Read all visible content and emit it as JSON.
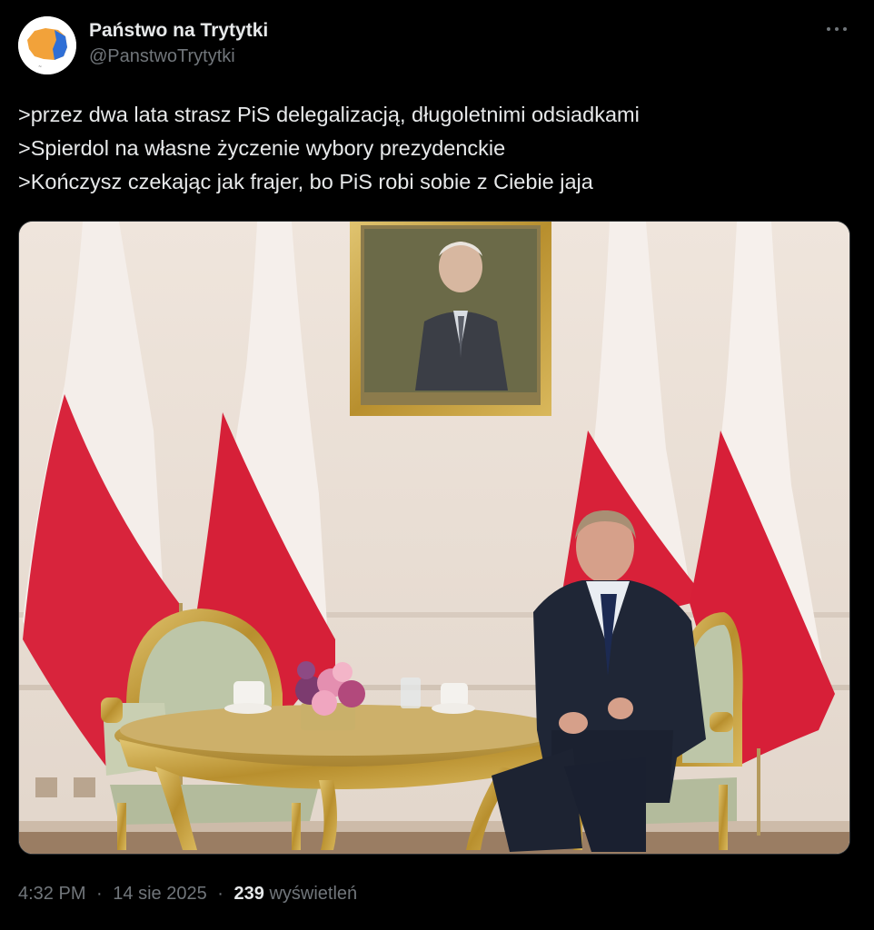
{
  "tweet": {
    "author": {
      "display_name": "Państwo na Trytytki",
      "handle": "@PanstwoTrytytki",
      "avatar_icon": "avatar-poland-map-icon"
    },
    "more_icon": "more-dots-icon",
    "lines": [
      ">przez dwa lata strasz PiS delegalizacją, długoletnimi odsiadkami",
      ">Spierdol na własne życzenie wybory prezydenckie",
      ">Kończysz czekając jak frajer, bo PiS robi sobie z Ciebie jaja"
    ],
    "time": "4:32 PM",
    "date": "14 sie 2025",
    "views_count": "239",
    "views_label": "wyświetleń",
    "separator": "·"
  },
  "colors": {
    "background": "#000000",
    "text": "#e7e9ea",
    "muted": "#71767b",
    "flag_red": "#dc1f3b",
    "flag_white": "#f6f1ee",
    "gold": "#c9a74a"
  }
}
